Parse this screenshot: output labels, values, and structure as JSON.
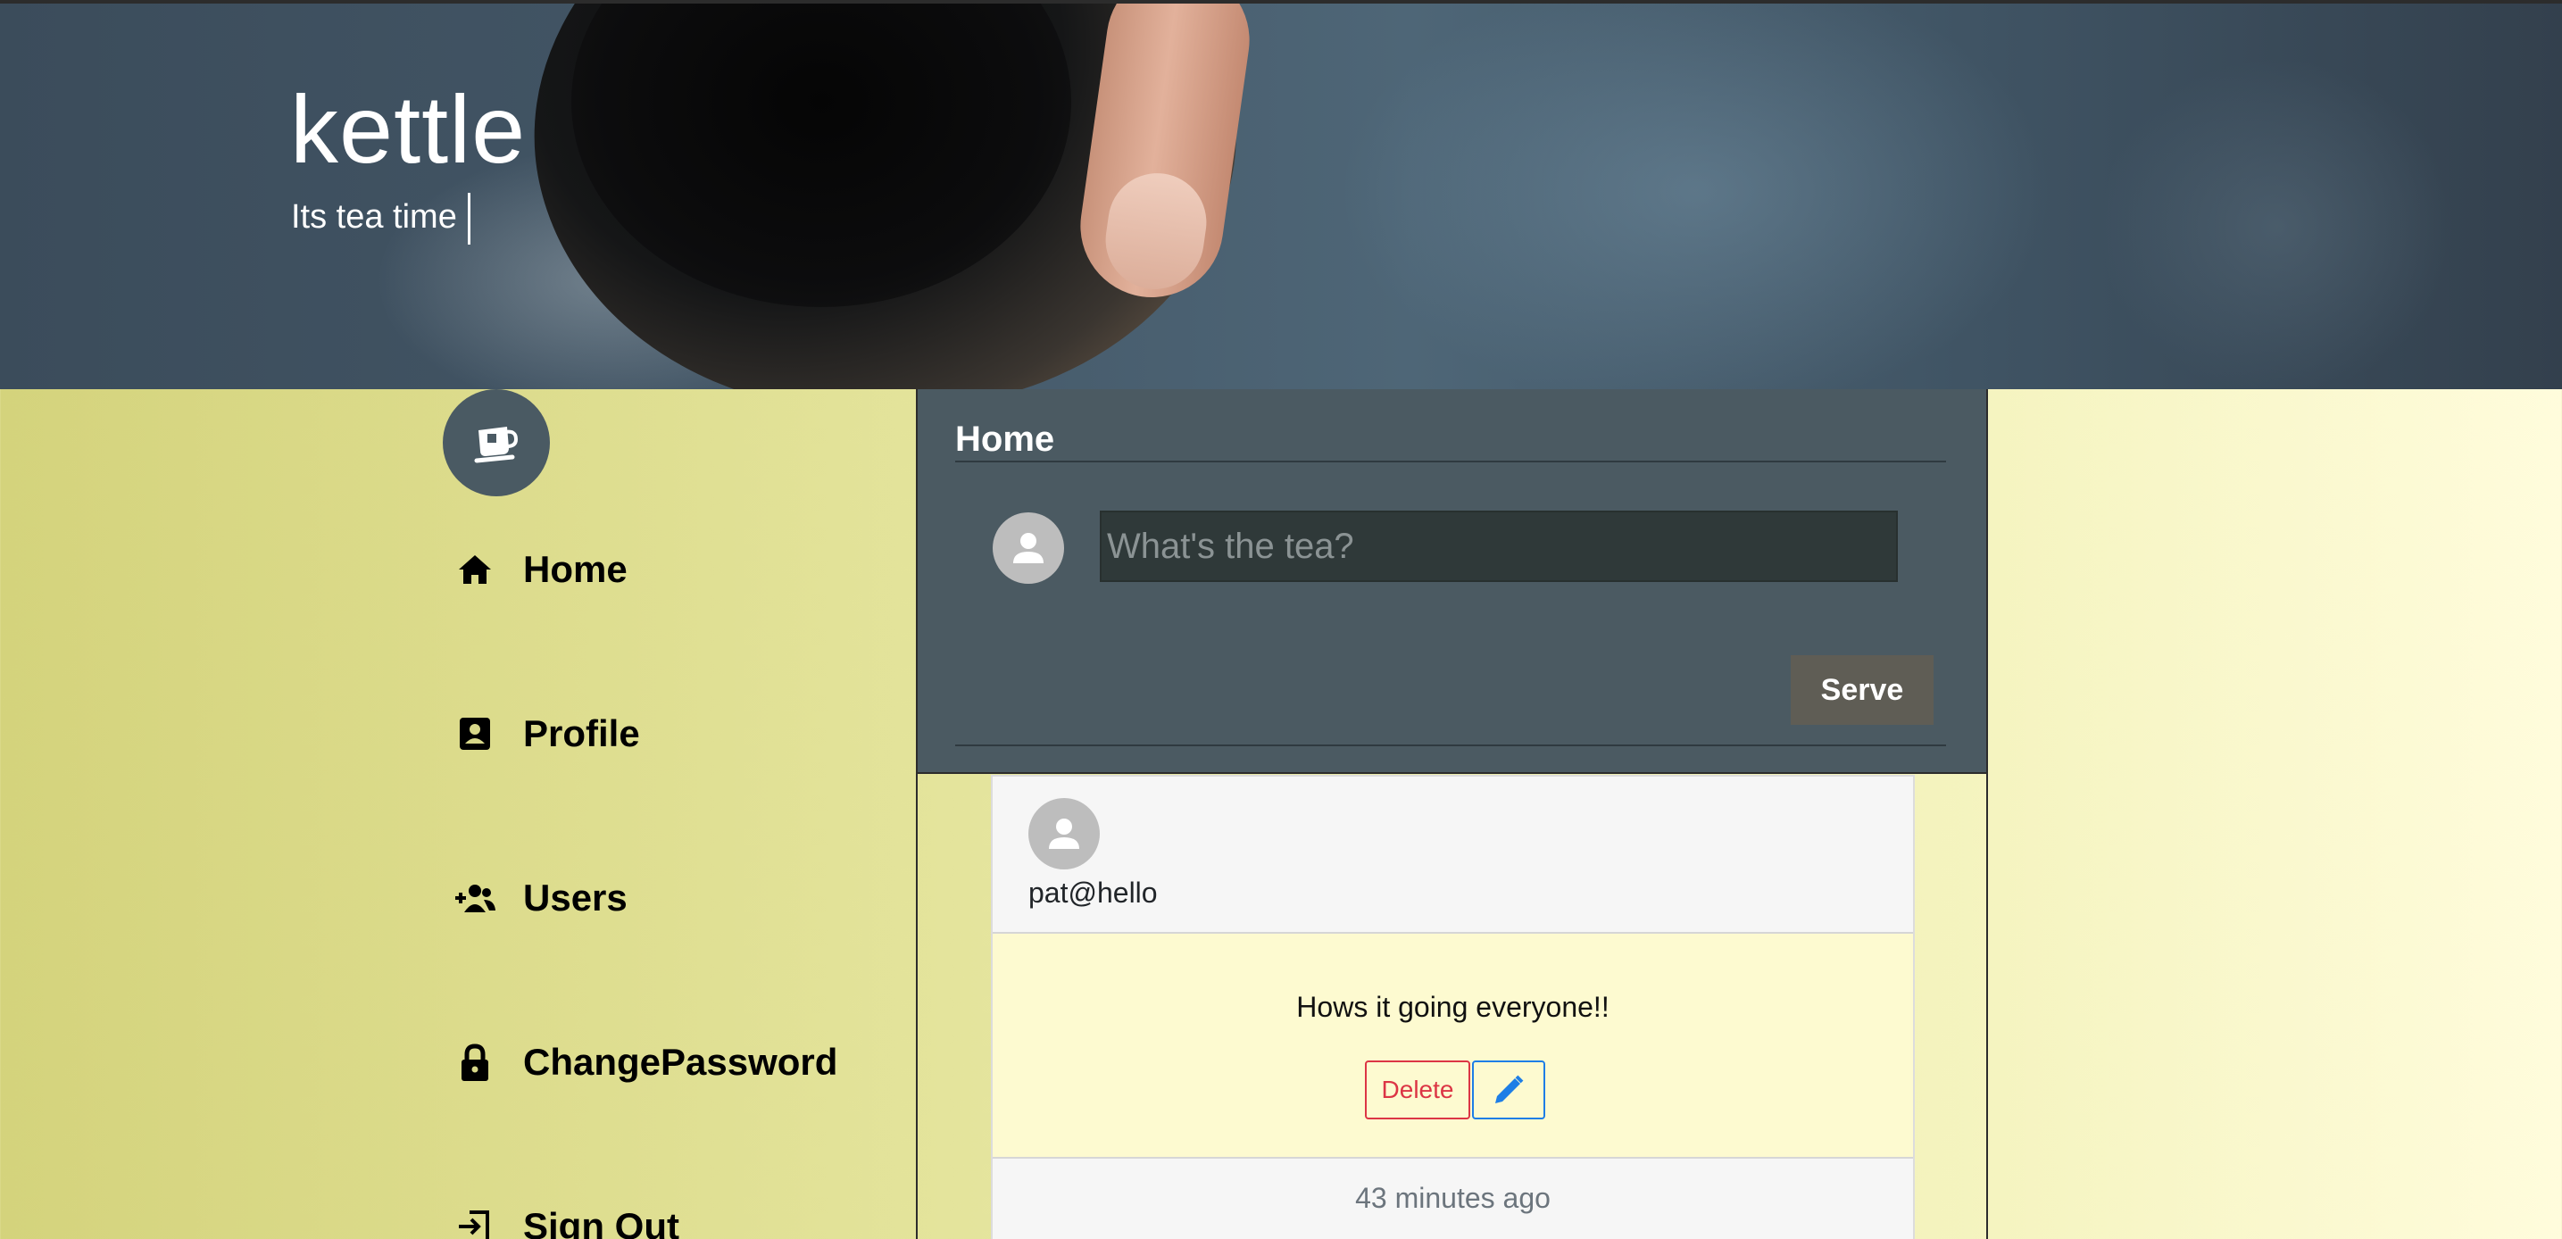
{
  "hero": {
    "title": "kettle",
    "subtitle": "Its tea time"
  },
  "sidebar": {
    "logo_icon": "teacup-logo-icon",
    "items": [
      {
        "label": "Home",
        "icon": "home-icon"
      },
      {
        "label": "Profile",
        "icon": "profile-badge-icon"
      },
      {
        "label": "Users",
        "icon": "user-add-icon"
      },
      {
        "label": "ChangePassword",
        "icon": "lock-icon"
      },
      {
        "label": "Sign Out",
        "icon": "sign-out-icon"
      }
    ]
  },
  "main": {
    "page_title": "Home",
    "composer": {
      "placeholder": "What's the tea?",
      "value": "",
      "submit_label": "Serve"
    },
    "posts": [
      {
        "user": "pat@hello",
        "text": "Hows it going everyone!!",
        "delete_label": "Delete",
        "edit_icon": "pencil-icon",
        "time": "43 minutes ago"
      }
    ]
  },
  "colors": {
    "composer_bg": "#4b5a62",
    "input_bg": "#2f3939",
    "serve_btn_bg": "#5f5d55",
    "post_body_bg": "#fdfad0",
    "delete_red": "#dc3545",
    "edit_blue": "#1e7ee6",
    "sidebar_bg": "#d4d37c"
  }
}
